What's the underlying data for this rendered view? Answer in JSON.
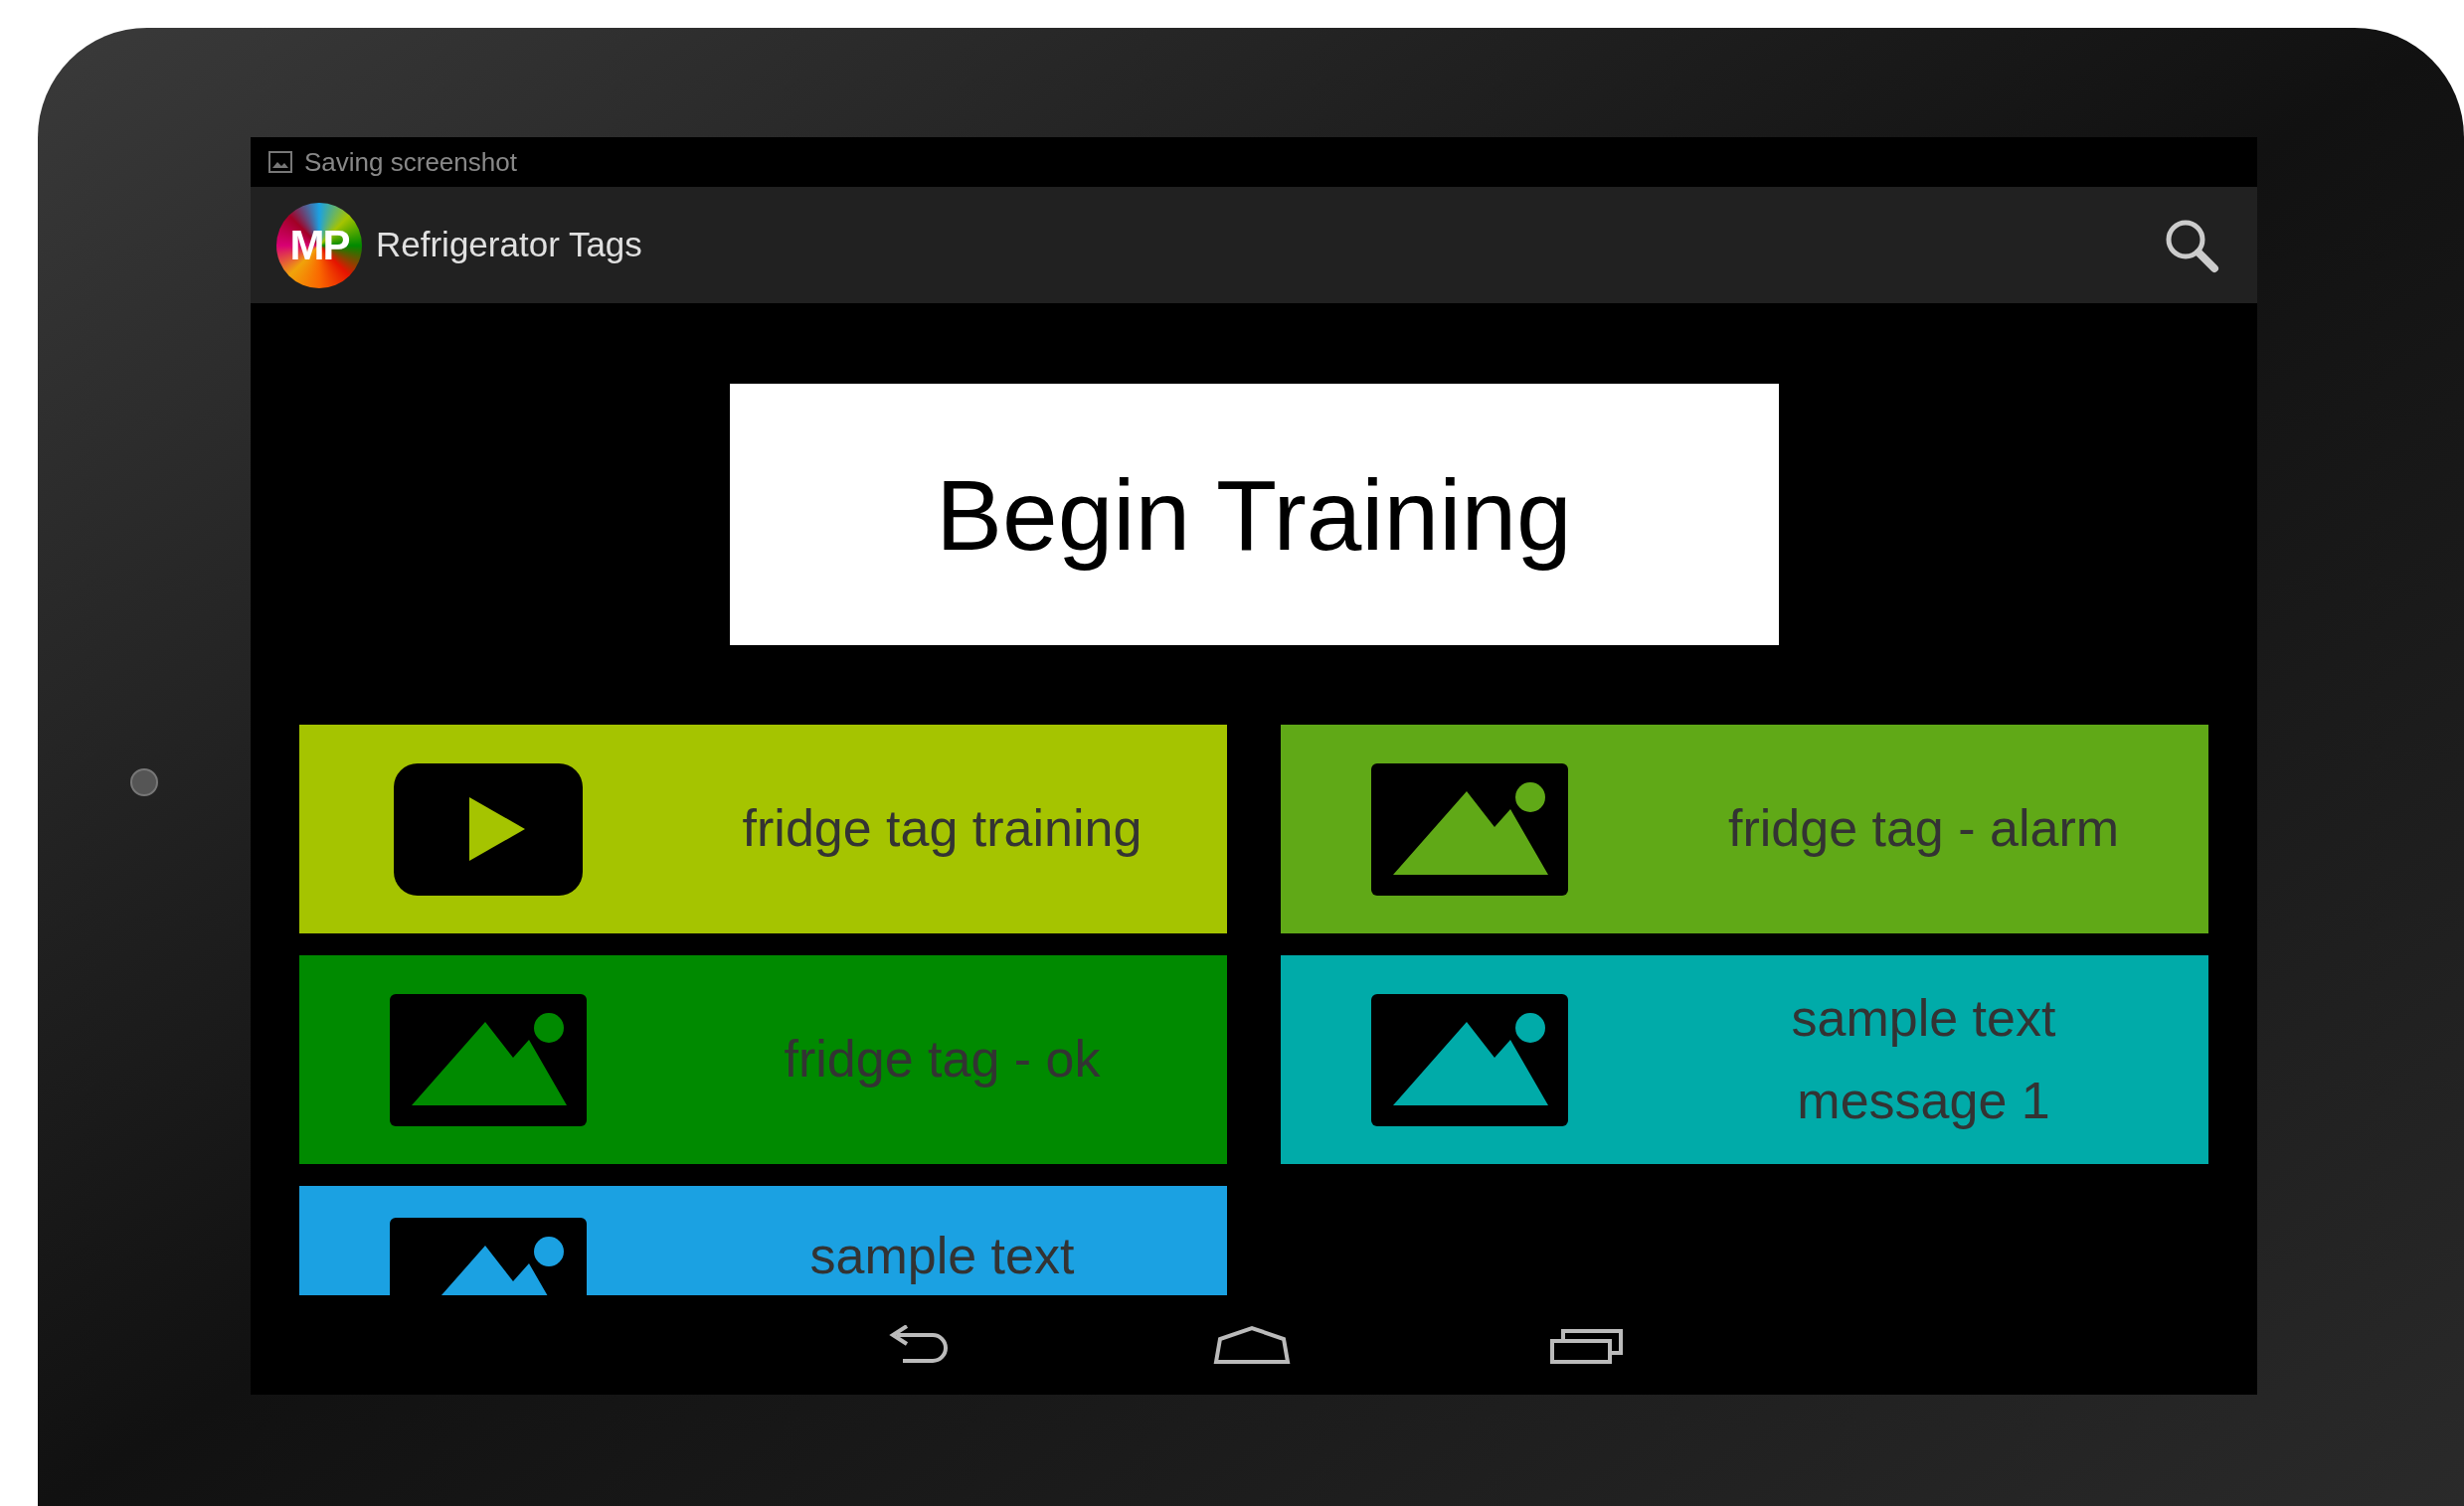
{
  "status_bar": {
    "notification": "Saving screenshot"
  },
  "app_bar": {
    "logo_text": "MP",
    "title": "Refrigerator Tags"
  },
  "begin_button": {
    "label": "Begin Training"
  },
  "tile_columns": [
    {
      "tiles": [
        {
          "label": "fridge tag training",
          "kind": "video",
          "color": "#a5c400"
        },
        {
          "label": "fridge tag - ok",
          "kind": "image",
          "color": "#008a00"
        },
        {
          "label": "sample text",
          "kind": "image",
          "color": "#1ba1e2"
        }
      ]
    },
    {
      "tiles": [
        {
          "label": "fridge tag - alarm",
          "kind": "image",
          "color": "#60a917"
        },
        {
          "label": "sample text message 1",
          "kind": "image",
          "color": "#00aba9"
        }
      ]
    }
  ]
}
